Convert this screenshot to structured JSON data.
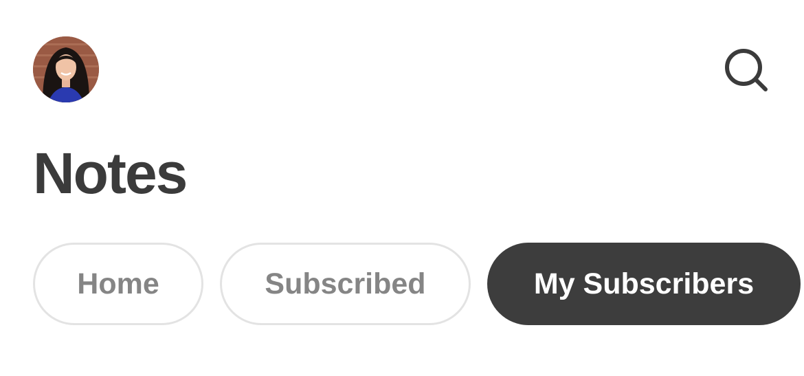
{
  "header": {
    "avatar_icon": "user-avatar",
    "search_icon": "search-icon"
  },
  "page": {
    "title": "Notes"
  },
  "tabs": [
    {
      "label": "Home",
      "active": false
    },
    {
      "label": "Subscribed",
      "active": false
    },
    {
      "label": "My Subscribers",
      "active": true
    }
  ],
  "colors": {
    "title": "#3b3b3b",
    "tab_active_bg": "#3d3d3d",
    "tab_active_text": "#ffffff",
    "tab_inactive_border": "#e3e3e3",
    "tab_inactive_text": "#858585",
    "icon": "#3b3b3b"
  }
}
